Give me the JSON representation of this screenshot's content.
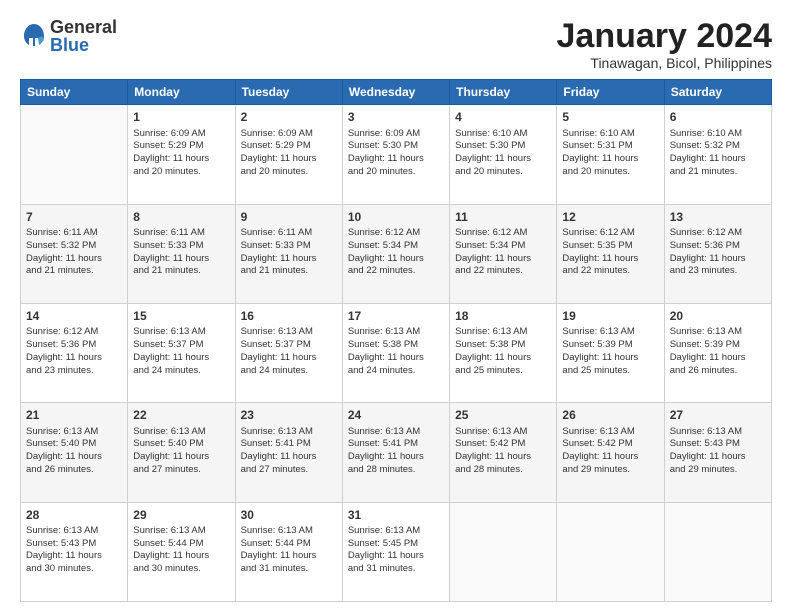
{
  "logo": {
    "general": "General",
    "blue": "Blue"
  },
  "header": {
    "title": "January 2024",
    "location": "Tinawagan, Bicol, Philippines"
  },
  "weekdays": [
    "Sunday",
    "Monday",
    "Tuesday",
    "Wednesday",
    "Thursday",
    "Friday",
    "Saturday"
  ],
  "weeks": [
    [
      {
        "day": "",
        "info": ""
      },
      {
        "day": "1",
        "info": "Sunrise: 6:09 AM\nSunset: 5:29 PM\nDaylight: 11 hours\nand 20 minutes."
      },
      {
        "day": "2",
        "info": "Sunrise: 6:09 AM\nSunset: 5:29 PM\nDaylight: 11 hours\nand 20 minutes."
      },
      {
        "day": "3",
        "info": "Sunrise: 6:09 AM\nSunset: 5:30 PM\nDaylight: 11 hours\nand 20 minutes."
      },
      {
        "day": "4",
        "info": "Sunrise: 6:10 AM\nSunset: 5:30 PM\nDaylight: 11 hours\nand 20 minutes."
      },
      {
        "day": "5",
        "info": "Sunrise: 6:10 AM\nSunset: 5:31 PM\nDaylight: 11 hours\nand 20 minutes."
      },
      {
        "day": "6",
        "info": "Sunrise: 6:10 AM\nSunset: 5:32 PM\nDaylight: 11 hours\nand 21 minutes."
      }
    ],
    [
      {
        "day": "7",
        "info": "Sunrise: 6:11 AM\nSunset: 5:32 PM\nDaylight: 11 hours\nand 21 minutes."
      },
      {
        "day": "8",
        "info": "Sunrise: 6:11 AM\nSunset: 5:33 PM\nDaylight: 11 hours\nand 21 minutes."
      },
      {
        "day": "9",
        "info": "Sunrise: 6:11 AM\nSunset: 5:33 PM\nDaylight: 11 hours\nand 21 minutes."
      },
      {
        "day": "10",
        "info": "Sunrise: 6:12 AM\nSunset: 5:34 PM\nDaylight: 11 hours\nand 22 minutes."
      },
      {
        "day": "11",
        "info": "Sunrise: 6:12 AM\nSunset: 5:34 PM\nDaylight: 11 hours\nand 22 minutes."
      },
      {
        "day": "12",
        "info": "Sunrise: 6:12 AM\nSunset: 5:35 PM\nDaylight: 11 hours\nand 22 minutes."
      },
      {
        "day": "13",
        "info": "Sunrise: 6:12 AM\nSunset: 5:36 PM\nDaylight: 11 hours\nand 23 minutes."
      }
    ],
    [
      {
        "day": "14",
        "info": "Sunrise: 6:12 AM\nSunset: 5:36 PM\nDaylight: 11 hours\nand 23 minutes."
      },
      {
        "day": "15",
        "info": "Sunrise: 6:13 AM\nSunset: 5:37 PM\nDaylight: 11 hours\nand 24 minutes."
      },
      {
        "day": "16",
        "info": "Sunrise: 6:13 AM\nSunset: 5:37 PM\nDaylight: 11 hours\nand 24 minutes."
      },
      {
        "day": "17",
        "info": "Sunrise: 6:13 AM\nSunset: 5:38 PM\nDaylight: 11 hours\nand 24 minutes."
      },
      {
        "day": "18",
        "info": "Sunrise: 6:13 AM\nSunset: 5:38 PM\nDaylight: 11 hours\nand 25 minutes."
      },
      {
        "day": "19",
        "info": "Sunrise: 6:13 AM\nSunset: 5:39 PM\nDaylight: 11 hours\nand 25 minutes."
      },
      {
        "day": "20",
        "info": "Sunrise: 6:13 AM\nSunset: 5:39 PM\nDaylight: 11 hours\nand 26 minutes."
      }
    ],
    [
      {
        "day": "21",
        "info": "Sunrise: 6:13 AM\nSunset: 5:40 PM\nDaylight: 11 hours\nand 26 minutes."
      },
      {
        "day": "22",
        "info": "Sunrise: 6:13 AM\nSunset: 5:40 PM\nDaylight: 11 hours\nand 27 minutes."
      },
      {
        "day": "23",
        "info": "Sunrise: 6:13 AM\nSunset: 5:41 PM\nDaylight: 11 hours\nand 27 minutes."
      },
      {
        "day": "24",
        "info": "Sunrise: 6:13 AM\nSunset: 5:41 PM\nDaylight: 11 hours\nand 28 minutes."
      },
      {
        "day": "25",
        "info": "Sunrise: 6:13 AM\nSunset: 5:42 PM\nDaylight: 11 hours\nand 28 minutes."
      },
      {
        "day": "26",
        "info": "Sunrise: 6:13 AM\nSunset: 5:42 PM\nDaylight: 11 hours\nand 29 minutes."
      },
      {
        "day": "27",
        "info": "Sunrise: 6:13 AM\nSunset: 5:43 PM\nDaylight: 11 hours\nand 29 minutes."
      }
    ],
    [
      {
        "day": "28",
        "info": "Sunrise: 6:13 AM\nSunset: 5:43 PM\nDaylight: 11 hours\nand 30 minutes."
      },
      {
        "day": "29",
        "info": "Sunrise: 6:13 AM\nSunset: 5:44 PM\nDaylight: 11 hours\nand 30 minutes."
      },
      {
        "day": "30",
        "info": "Sunrise: 6:13 AM\nSunset: 5:44 PM\nDaylight: 11 hours\nand 31 minutes."
      },
      {
        "day": "31",
        "info": "Sunrise: 6:13 AM\nSunset: 5:45 PM\nDaylight: 11 hours\nand 31 minutes."
      },
      {
        "day": "",
        "info": ""
      },
      {
        "day": "",
        "info": ""
      },
      {
        "day": "",
        "info": ""
      }
    ]
  ]
}
